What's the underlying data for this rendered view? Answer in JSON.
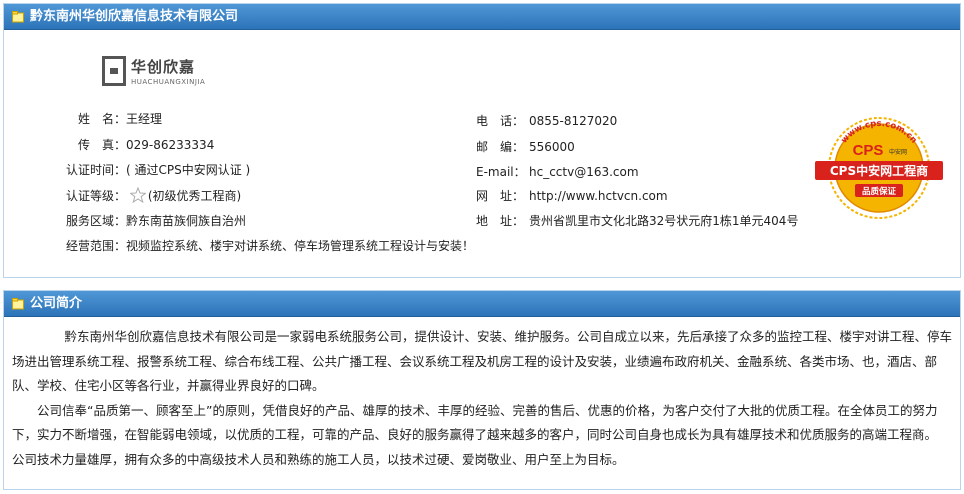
{
  "company_panel": {
    "title": "黔东南州华创欣嘉信息技术有限公司",
    "logo": {
      "cn": "华创欣嘉",
      "en": "HUACHUANGXINJIA"
    },
    "left_fields": [
      {
        "label": "姓　名：",
        "value": "王经理"
      },
      {
        "label": "传　真：",
        "value": "029-86233334"
      },
      {
        "label": "认证时间：",
        "value": "( 通过CPS中安网认证 )"
      },
      {
        "label": "认证等级：",
        "value": "(初级优秀工程商)"
      },
      {
        "label": "服务区域：",
        "value": "黔东南苗族侗族自治州"
      },
      {
        "label": "经营范围：",
        "value": "视频监控系统、楼宇对讲系统、停车场管理系统工程设计与安装！"
      }
    ],
    "right_fields": [
      {
        "label": "电　话：",
        "value": "0855-8127020"
      },
      {
        "label": "邮　编：",
        "value": "556000"
      },
      {
        "label": "E-mail：",
        "value": "hc_cctv@163.com"
      },
      {
        "label": "网　址：",
        "value": "http://www.hctvcn.com"
      },
      {
        "label": "地　址：",
        "value": "贵州省凯里市文化北路32号状元府1栋1单元404号"
      }
    ],
    "badge": {
      "url_text": "www.cps.com.cn",
      "cps": "CPS",
      "cps_small": "中安网",
      "ribbon": "CPS中安网工程商",
      "bottom": "品质保证"
    }
  },
  "intro_panel": {
    "title": "公司简介",
    "paragraphs": [
      "黔东南州华创欣嘉信息技术有限公司是一家弱电系统服务公司，提供设计、安装、维护服务。公司自成立以来，先后承接了众多的监控工程、楼宇对讲工程、停车场进出管理系统工程、报警系统工程、综合布线工程、公共广播工程、会议系统工程及机房工程的设计及安装，业绩遍布政府机关、金融系统、各类市场、也，酒店、部队、学校、住宅小区等各行业，并赢得业界良好的口碑。",
      "公司信奉“品质第一、顾客至上”的原则，凭借良好的产品、雄厚的技术、丰厚的经验、完善的售后、优惠的价格，为客户交付了大批的优质工程。在全体员工的努力下，实力不断增强，在智能弱电领域，以优质的工程，可靠的产品、良好的服务赢得了越来越多的客户，同时公司自身也成长为具有雄厚技术和优质服务的高端工程商。 公司技术力量雄厚，拥有众多的中高级技术人员和熟练的施工人员，以技术过硬、爱岗敬业、用户至上为目标。"
    ]
  },
  "colors": {
    "header_top": "#4f97d6",
    "header_bottom": "#2c74b8",
    "border": "#b8d3ea",
    "badge_red": "#d9221c",
    "badge_gold": "#f5b400"
  },
  "icons": {
    "header": "folder-icon",
    "rating": "star-icon"
  }
}
